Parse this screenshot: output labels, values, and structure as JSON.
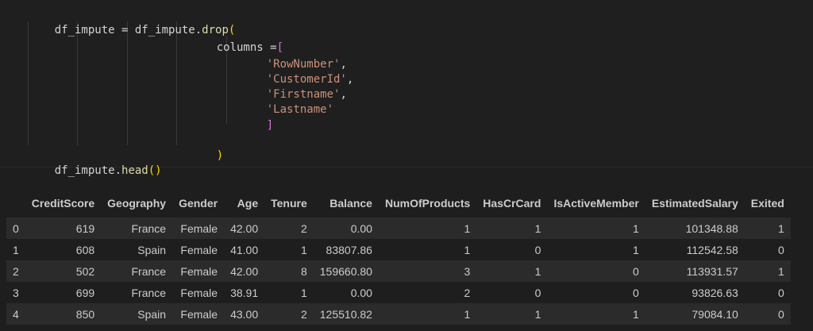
{
  "code": {
    "lines": [
      {
        "p1": "df_impute = df_impute.",
        "fn": "drop",
        "b": "("
      },
      {
        "p1": "columns =",
        "b": "["
      },
      {
        "s": "'RowNumber'",
        "c": ","
      },
      {
        "s": "'CustomerId'",
        "c": ","
      },
      {
        "s": "'Firstname'",
        "c": ","
      },
      {
        "s": "'Lastname'"
      },
      {
        "b": "]"
      },
      {
        "b": ")"
      },
      {
        "p1": "df_impute.",
        "fn": "head",
        "b": "()"
      }
    ]
  },
  "table": {
    "columns": [
      "CreditScore",
      "Geography",
      "Gender",
      "Age",
      "Tenure",
      "Balance",
      "NumOfProducts",
      "HasCrCard",
      "IsActiveMember",
      "EstimatedSalary",
      "Exited"
    ],
    "rows": [
      {
        "index": "0",
        "cells": [
          "619",
          "France",
          "Female",
          "42.00",
          "2",
          "0.00",
          "1",
          "1",
          "1",
          "101348.88",
          "1"
        ]
      },
      {
        "index": "1",
        "cells": [
          "608",
          "Spain",
          "Female",
          "41.00",
          "1",
          "83807.86",
          "1",
          "0",
          "1",
          "112542.58",
          "0"
        ]
      },
      {
        "index": "2",
        "cells": [
          "502",
          "France",
          "Female",
          "42.00",
          "8",
          "159660.80",
          "3",
          "1",
          "0",
          "113931.57",
          "1"
        ]
      },
      {
        "index": "3",
        "cells": [
          "699",
          "France",
          "Female",
          "38.91",
          "1",
          "0.00",
          "2",
          "0",
          "0",
          "93826.63",
          "0"
        ]
      },
      {
        "index": "4",
        "cells": [
          "850",
          "Spain",
          "Female",
          "43.00",
          "2",
          "125510.82",
          "1",
          "1",
          "1",
          "79084.10",
          "0"
        ]
      }
    ]
  }
}
